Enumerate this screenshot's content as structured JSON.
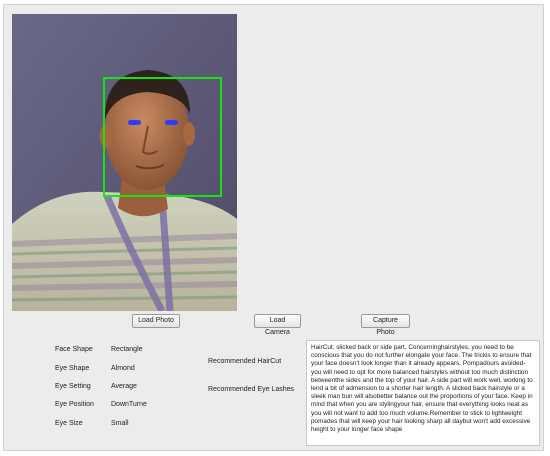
{
  "buttons": {
    "load_photo": "Load Photo",
    "load_camera": "Load Camera",
    "capture_photo": "Capture Photo"
  },
  "attributes": [
    {
      "label": "Face Shape",
      "value": "Rectangle"
    },
    {
      "label": "Eye Shape",
      "value": "Almond"
    },
    {
      "label": "Eye Setting",
      "value": "Average"
    },
    {
      "label": "Eye Position",
      "value": "DownTurne"
    },
    {
      "label": "Eye Size",
      "value": "Small"
    }
  ],
  "recommendations": {
    "haircut_label": "Recommended HairCut",
    "eyelashes_label": "Recommended Eye Lashes"
  },
  "result_text": "HairCut: slicked back or side part. Concerninghairstyles, you need to be conscious that you do not further elongate your face. The trickis to ensure that your face doesn't look longer than it already appears. Pompadours avoided- you will need to opt for more balanced hairstyles without too much distinction betweenthe sides and the top of your hair. A side part will work well, working to lend a bit of admension to a shorter hair length. A slicked back hairstyle or a sleek man bun will alsobetter balance out the proportions of your face. Keep in mind that when you are stylingyour hair, ensure that everything looks neat as you will not want to add too much volume.Remember to stick to lightweight pomades that will keep your hair looking sharp all daybut won't add excessive height to your longer face shape",
  "colors": {
    "face_box": "#17e30e",
    "eye_marker": "#2f3cff",
    "window_bg": "#ececec"
  }
}
